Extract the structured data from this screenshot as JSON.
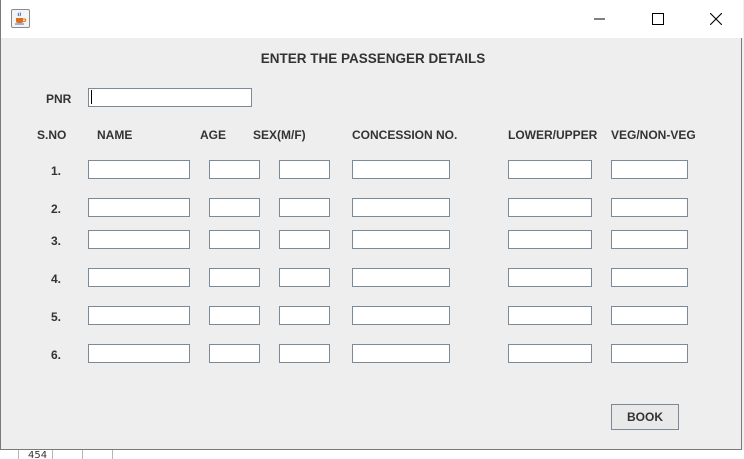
{
  "window": {
    "icon": "java-coffee-cup-icon",
    "controls": {
      "minimize": "minimize-icon",
      "maximize": "maximize-icon",
      "close": "close-icon"
    }
  },
  "form": {
    "heading": "ENTER THE PASSENGER DETAILS",
    "pnr_label": "PNR",
    "pnr_value": "",
    "columns": {
      "sno": "S.NO",
      "name": "NAME",
      "age": "AGE",
      "sex": "SEX(M/F)",
      "concession": "CONCESSION NO.",
      "berth": "LOWER/UPPER",
      "meal": "VEG/NON-VEG"
    },
    "rows": [
      {
        "sno": "1.",
        "name": "",
        "age": "",
        "sex": "",
        "concession": "",
        "berth": "",
        "meal": ""
      },
      {
        "sno": "2.",
        "name": "",
        "age": "",
        "sex": "",
        "concession": "",
        "berth": "",
        "meal": ""
      },
      {
        "sno": "3.",
        "name": "",
        "age": "",
        "sex": "",
        "concession": "",
        "berth": "",
        "meal": ""
      },
      {
        "sno": "4.",
        "name": "",
        "age": "",
        "sex": "",
        "concession": "",
        "berth": "",
        "meal": ""
      },
      {
        "sno": "5.",
        "name": "",
        "age": "",
        "sex": "",
        "concession": "",
        "berth": "",
        "meal": ""
      },
      {
        "sno": "6.",
        "name": "",
        "age": "",
        "sex": "",
        "concession": "",
        "berth": "",
        "meal": ""
      }
    ],
    "book_label": "BOOK"
  },
  "background_app": {
    "visible_number": "454"
  }
}
